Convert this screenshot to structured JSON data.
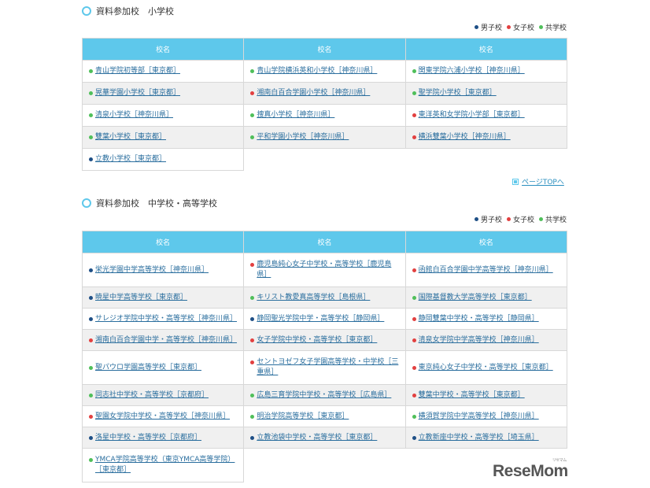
{
  "colors": {
    "boys": "#1e4f86",
    "girls": "#e24040",
    "coed": "#4fbf5a",
    "header": "#5ec8eb"
  },
  "legend": {
    "boys": "男子校",
    "girls": "女子校",
    "coed": "共学校"
  },
  "elementary": {
    "title": "資料参加校　小学校",
    "headers": [
      "校名",
      "校名",
      "校名"
    ],
    "rows": [
      [
        {
          "type": "coed",
          "name": "青山学院初等部［東京都］"
        },
        {
          "type": "coed",
          "name": "青山学院横浜英和小学校［神奈川県］"
        },
        {
          "type": "coed",
          "name": "関東学院六浦小学校［神奈川県］"
        }
      ],
      [
        {
          "type": "coed",
          "name": "晃華学園小学校［東京都］"
        },
        {
          "type": "girls",
          "name": "湘南白百合学園小学校［神奈川県］"
        },
        {
          "type": "coed",
          "name": "聖学院小学校［東京都］"
        }
      ],
      [
        {
          "type": "coed",
          "name": "清泉小学校［神奈川県］"
        },
        {
          "type": "coed",
          "name": "捜真小学校［神奈川県］"
        },
        {
          "type": "girls",
          "name": "東洋英和女学院小学部［東京都］"
        }
      ],
      [
        {
          "type": "coed",
          "name": "雙葉小学校［東京都］"
        },
        {
          "type": "coed",
          "name": "平和学園小学校［神奈川県］"
        },
        {
          "type": "girls",
          "name": "横浜雙葉小学校［神奈川県］"
        }
      ],
      [
        {
          "type": "boys",
          "name": "立教小学校［東京都］"
        }
      ]
    ]
  },
  "pagetop": "ページTOPへ",
  "secondary": {
    "title": "資料参加校　中学校・高等学校",
    "headers": [
      "校名",
      "校名",
      "校名"
    ],
    "rows": [
      [
        {
          "type": "boys",
          "name": "栄光学園中学高等学校［神奈川県］"
        },
        {
          "type": "girls",
          "name": "鹿児島純心女子中学校・高等学校［鹿児島県］"
        },
        {
          "type": "girls",
          "name": "函館白百合学園中学高等学校［神奈川県］"
        }
      ],
      [
        {
          "type": "boys",
          "name": "暁星中学高等学校［東京都］"
        },
        {
          "type": "coed",
          "name": "キリスト教愛真高等学校［島根県］"
        },
        {
          "type": "coed",
          "name": "国際基督教大学高等学校［東京都］"
        }
      ],
      [
        {
          "type": "boys",
          "name": "サレジオ学院中学校・高等学校［神奈川県］"
        },
        {
          "type": "boys",
          "name": "静岡聖光学院中学・高等学校［静岡県］"
        },
        {
          "type": "girls",
          "name": "静岡雙葉中学校・高等学校［静岡県］"
        }
      ],
      [
        {
          "type": "girls",
          "name": "湘南白百合学園中学・高等学校［神奈川県］"
        },
        {
          "type": "girls",
          "name": "女子学院中学校・高等学校［東京都］"
        },
        {
          "type": "girls",
          "name": "清泉女学院中学高等学校［神奈川県］"
        }
      ],
      [
        {
          "type": "coed",
          "name": "聖パウロ学園高等学校［東京都］"
        },
        {
          "type": "girls",
          "name": "セントヨゼフ女子学園高等学校・中学校［三重県］"
        },
        {
          "type": "girls",
          "name": "東京純心女子中学校・高等学校［東京都］"
        }
      ],
      [
        {
          "type": "coed",
          "name": "同志社中学校・高等学校［京都府］"
        },
        {
          "type": "coed",
          "name": "広島三育学院中学校・高等学校［広島県］"
        },
        {
          "type": "girls",
          "name": "雙葉中学校・高等学校［東京都］"
        }
      ],
      [
        {
          "type": "girls",
          "name": "聖園女学院中学校・高等学校［神奈川県］"
        },
        {
          "type": "coed",
          "name": "明治学院高等学校［東京都］"
        },
        {
          "type": "coed",
          "name": "横須賀学院中学高等学校［神奈川県］"
        }
      ],
      [
        {
          "type": "boys",
          "name": "洛星中学校・高等学校［京都府］"
        },
        {
          "type": "boys",
          "name": "立教池袋中学校・高等学校［東京都］"
        },
        {
          "type": "boys",
          "name": "立教新座中学校・高等学校［埼玉県］"
        }
      ],
      [
        {
          "type": "coed",
          "name": "YMCA学院高等学校（東京YMCA高等学院）［東京都］"
        }
      ]
    ]
  },
  "logo": {
    "text": "ReseMom",
    "kana": "リセマム"
  }
}
